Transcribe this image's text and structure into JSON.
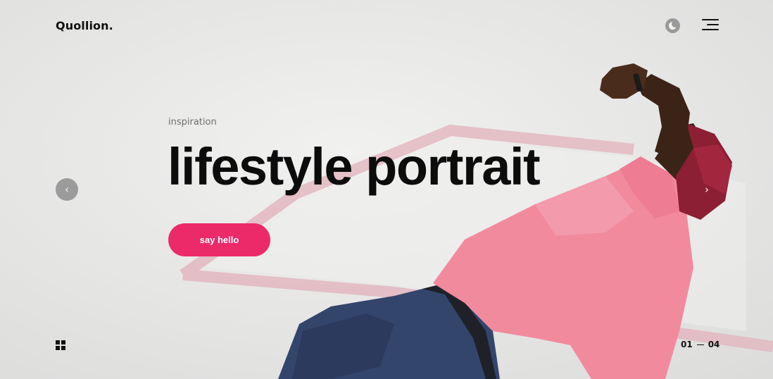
{
  "brand": {
    "name": "Quollion."
  },
  "hero": {
    "kicker": "inspiration",
    "headline": "lifestyle portrait",
    "cta_label": "say hello"
  },
  "slider": {
    "prev_label": "‹",
    "next_label": "›",
    "current": "01",
    "total": "04"
  },
  "icons": {
    "theme": "moon-icon",
    "menu": "hamburger-menu-icon",
    "grid": "grid-icon",
    "prev": "chevron-left-icon",
    "next": "chevron-right-icon"
  },
  "colors": {
    "accent": "#ec2a6a",
    "text": "#0c0c0c",
    "background": "#e9e9e8",
    "shirt": "#f28a9e",
    "pants": "#34456c"
  }
}
